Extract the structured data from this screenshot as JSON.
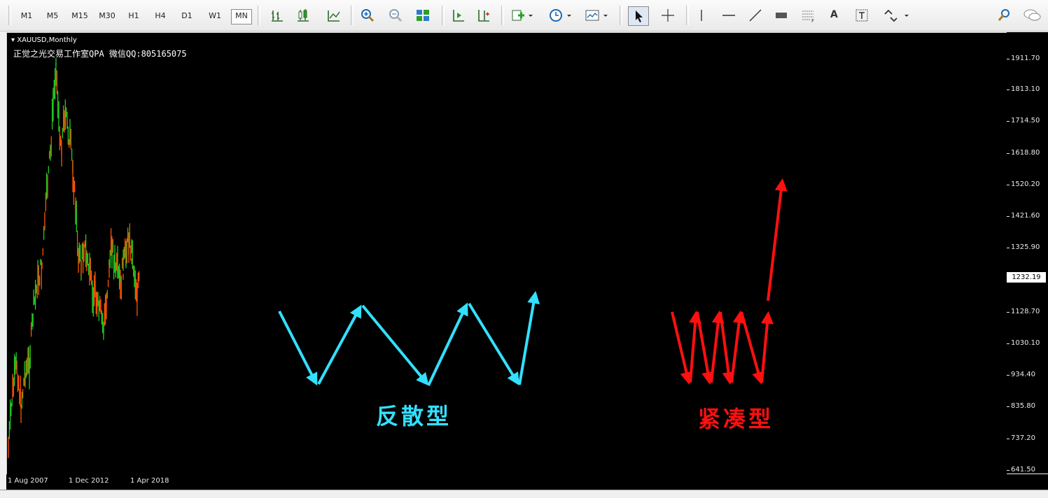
{
  "toolbar": {
    "timeframes": [
      "M1",
      "M5",
      "M15",
      "M30",
      "H1",
      "H4",
      "D1",
      "W1",
      "MN"
    ],
    "active_timeframe": "MN",
    "tools_text": "A"
  },
  "chart": {
    "symbol_label": "XAUUSD,Monthly",
    "watermark": "正觉之光交易工作室QPA 微信QQ:805165075",
    "current_price": "1232.19",
    "price_labels": [
      "1911.70",
      "1813.10",
      "1714.50",
      "1618.80",
      "1520.20",
      "1421.60",
      "1325.90",
      "1128.70",
      "1030.10",
      "934.40",
      "835.80",
      "737.20",
      "641.50"
    ],
    "time_labels": [
      "1 Aug 2007",
      "1 Dec 2012",
      "1 Apr 2018"
    ],
    "annotations": {
      "dispersed_label": "反散型",
      "compact_label": "紧凑型",
      "dispersed_color": "#33e0ff",
      "compact_color": "#ff1010"
    },
    "candle_colors": {
      "up": "#22cc22",
      "down": "#ff5500"
    }
  }
}
